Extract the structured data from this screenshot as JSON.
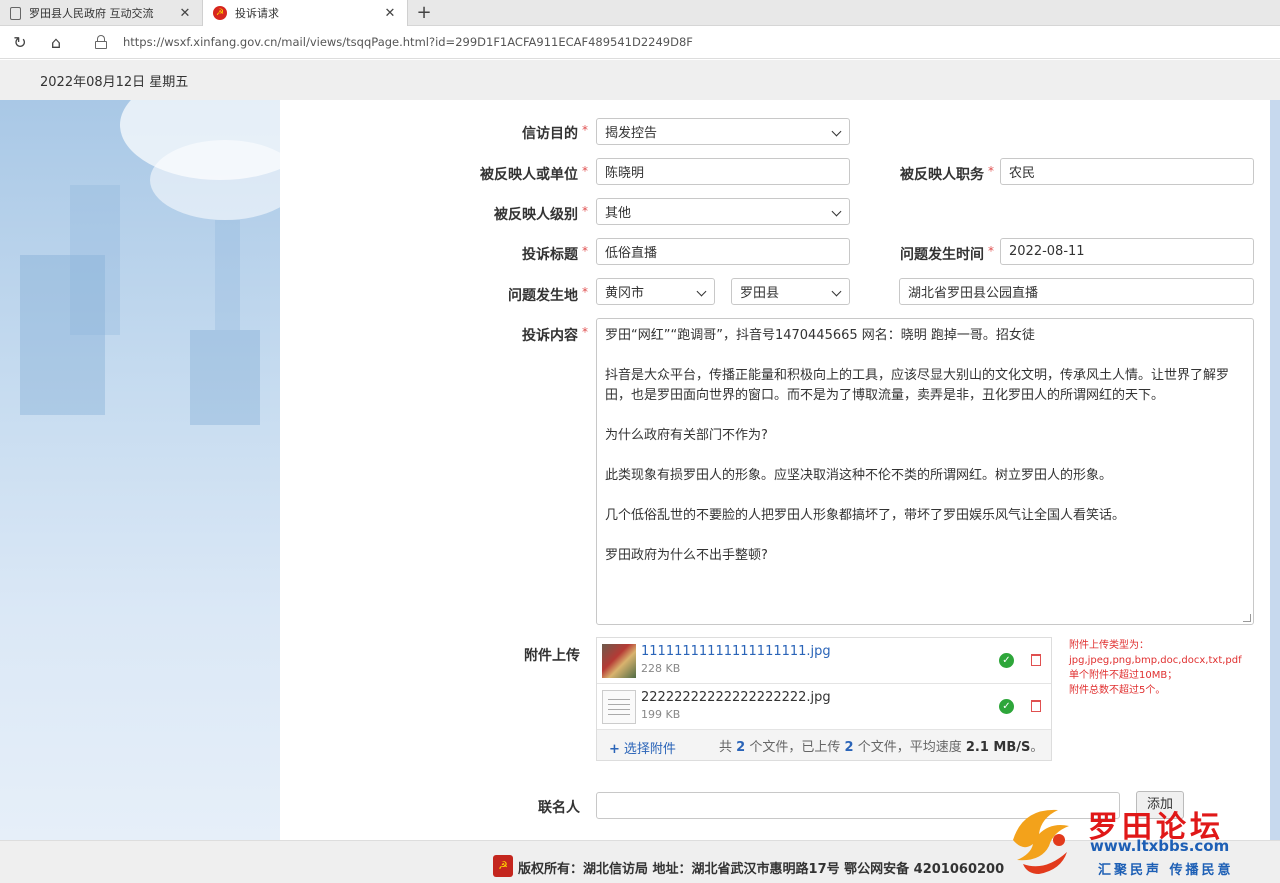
{
  "browser": {
    "tabs": [
      {
        "title": "罗田县人民政府 互动交流"
      },
      {
        "title": "投诉请求"
      }
    ],
    "url": "https://wsxf.xinfang.gov.cn/mail/views/tsqqPage.html?id=299D1F1ACFA911ECAF489541D2249D8F"
  },
  "header": {
    "date": "2022年08月12日 星期五"
  },
  "form": {
    "purpose": {
      "label": "信访目的",
      "value": "揭发控告"
    },
    "reported_person": {
      "label": "被反映人或单位",
      "value": "陈晓明"
    },
    "reported_position": {
      "label": "被反映人职务",
      "value": "农民"
    },
    "reported_level": {
      "label": "被反映人级别",
      "value": "其他"
    },
    "complaint_title": {
      "label": "投诉标题",
      "value": "低俗直播"
    },
    "occur_time": {
      "label": "问题发生时间",
      "value": "2022-08-11"
    },
    "location": {
      "label": "问题发生地",
      "city": "黄冈市",
      "county": "罗田县",
      "detail": "湖北省罗田县公园直播"
    },
    "content": {
      "label": "投诉内容",
      "paragraphs": [
        "罗田“网红”“跑调哥”，抖音号1470445665  网名：晓明 跑掉一哥。招女徒",
        "抖音是大众平台，传播正能量和积极向上的工具，应该尽显大别山的文化文明，传承风土人情。让世界了解罗田，也是罗田面向世界的窗口。而不是为了博取流量，卖弄是非，丑化罗田人的所谓网红的天下。",
        "为什么政府有关部门不作为?",
        "此类现象有损罗田人的形象。应坚决取消这种不伦不类的所谓网红。树立罗田人的形象。",
        "几个低俗乱世的不要脸的人把罗田人形象都搞坏了，带坏了罗田娱乐风气让全国人看笑话。",
        "罗田政府为什么不出手整顿?"
      ]
    },
    "attachments": {
      "label": "附件上传",
      "files": [
        {
          "name": "11111111111111111111.jpg",
          "size": "228 KB"
        },
        {
          "name": "22222222222222222222.jpg",
          "size": "199 KB"
        }
      ],
      "add_label": "选择附件",
      "status": {
        "prefix": "共",
        "total": "2",
        "mid1": "个文件，已上传",
        "uploaded": "2",
        "mid2": "个文件，平均速度",
        "speed": "2.1 MB/S",
        "suffix": "。"
      },
      "hint": [
        "附件上传类型为：",
        "jpg,jpeg,png,bmp,doc,docx,txt,pdf",
        "单个附件不超过10MB；",
        "附件总数不超过5个。"
      ]
    },
    "contact": {
      "label": "联名人",
      "value": "",
      "add_label": "添加"
    }
  },
  "footer": {
    "copyright": "版权所有：湖北信访局    地址：湖北省武汉市惠明路17号    鄂公网安备 4201060200"
  },
  "watermark": {
    "title": "罗田论坛",
    "url": "www.ltxbbs.com",
    "slogan": "汇聚民声 传播民意"
  },
  "colors": {
    "required_mark": "#e05050",
    "link": "#2a64b8",
    "hint_red": "#e03030",
    "success": "#2ea63a"
  }
}
